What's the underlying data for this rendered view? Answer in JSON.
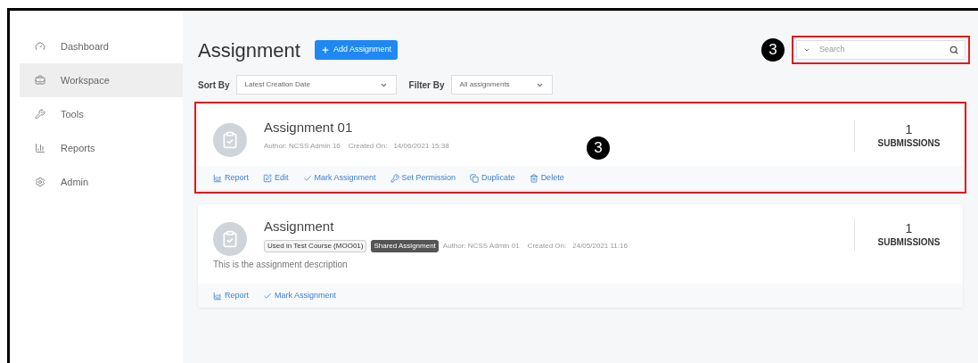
{
  "sidebar": {
    "items": [
      {
        "label": "Dashboard",
        "kind": "dashboard",
        "selected": false
      },
      {
        "label": "Workspace",
        "kind": "workspace",
        "selected": true
      },
      {
        "label": "Tools",
        "kind": "tools",
        "selected": false
      },
      {
        "label": "Reports",
        "kind": "reports",
        "selected": false
      },
      {
        "label": "Admin",
        "kind": "admin",
        "selected": false
      }
    ]
  },
  "header": {
    "title": "Assignment",
    "add_button": "Add Assignment",
    "search": {
      "placeholder": "Search",
      "highlighted": true,
      "callout": "3"
    }
  },
  "filters": {
    "sort_label": "Sort By",
    "sort_value": "Latest Creation Date",
    "filter_label": "Filter By",
    "filter_value": "All assignments"
  },
  "assignments": [
    {
      "title": "Assignment 01",
      "author": "Author: NCSS Admin 16",
      "created_label": "Created On:",
      "created": "14/06/2021 15:38",
      "count": "1",
      "count_label": "SUBMISSIONS",
      "highlighted": true,
      "callout": "3",
      "actions": [
        {
          "label": "Report",
          "kind": "report"
        },
        {
          "label": "Edit",
          "kind": "edit"
        },
        {
          "label": "Mark Assignment",
          "kind": "mark"
        },
        {
          "label": "Set Permission",
          "kind": "permission"
        },
        {
          "label": "Duplicate",
          "kind": "duplicate"
        },
        {
          "label": "Delete",
          "kind": "delete"
        }
      ]
    },
    {
      "title": "Assignment",
      "tags": [
        {
          "label": "Used in Test Course (MOO01)",
          "kind": "outline"
        },
        {
          "label": "Shared Assignment",
          "kind": "dark"
        }
      ],
      "author": "Author: NCSS Admin 01",
      "created_label": "Created On:",
      "created": "24/05/2021 11:16",
      "description": "This is the assignment description",
      "count": "1",
      "count_label": "SUBMISSIONS",
      "highlighted": false,
      "actions": [
        {
          "label": "Report",
          "kind": "report"
        },
        {
          "label": "Mark Assignment",
          "kind": "mark"
        }
      ]
    }
  ]
}
